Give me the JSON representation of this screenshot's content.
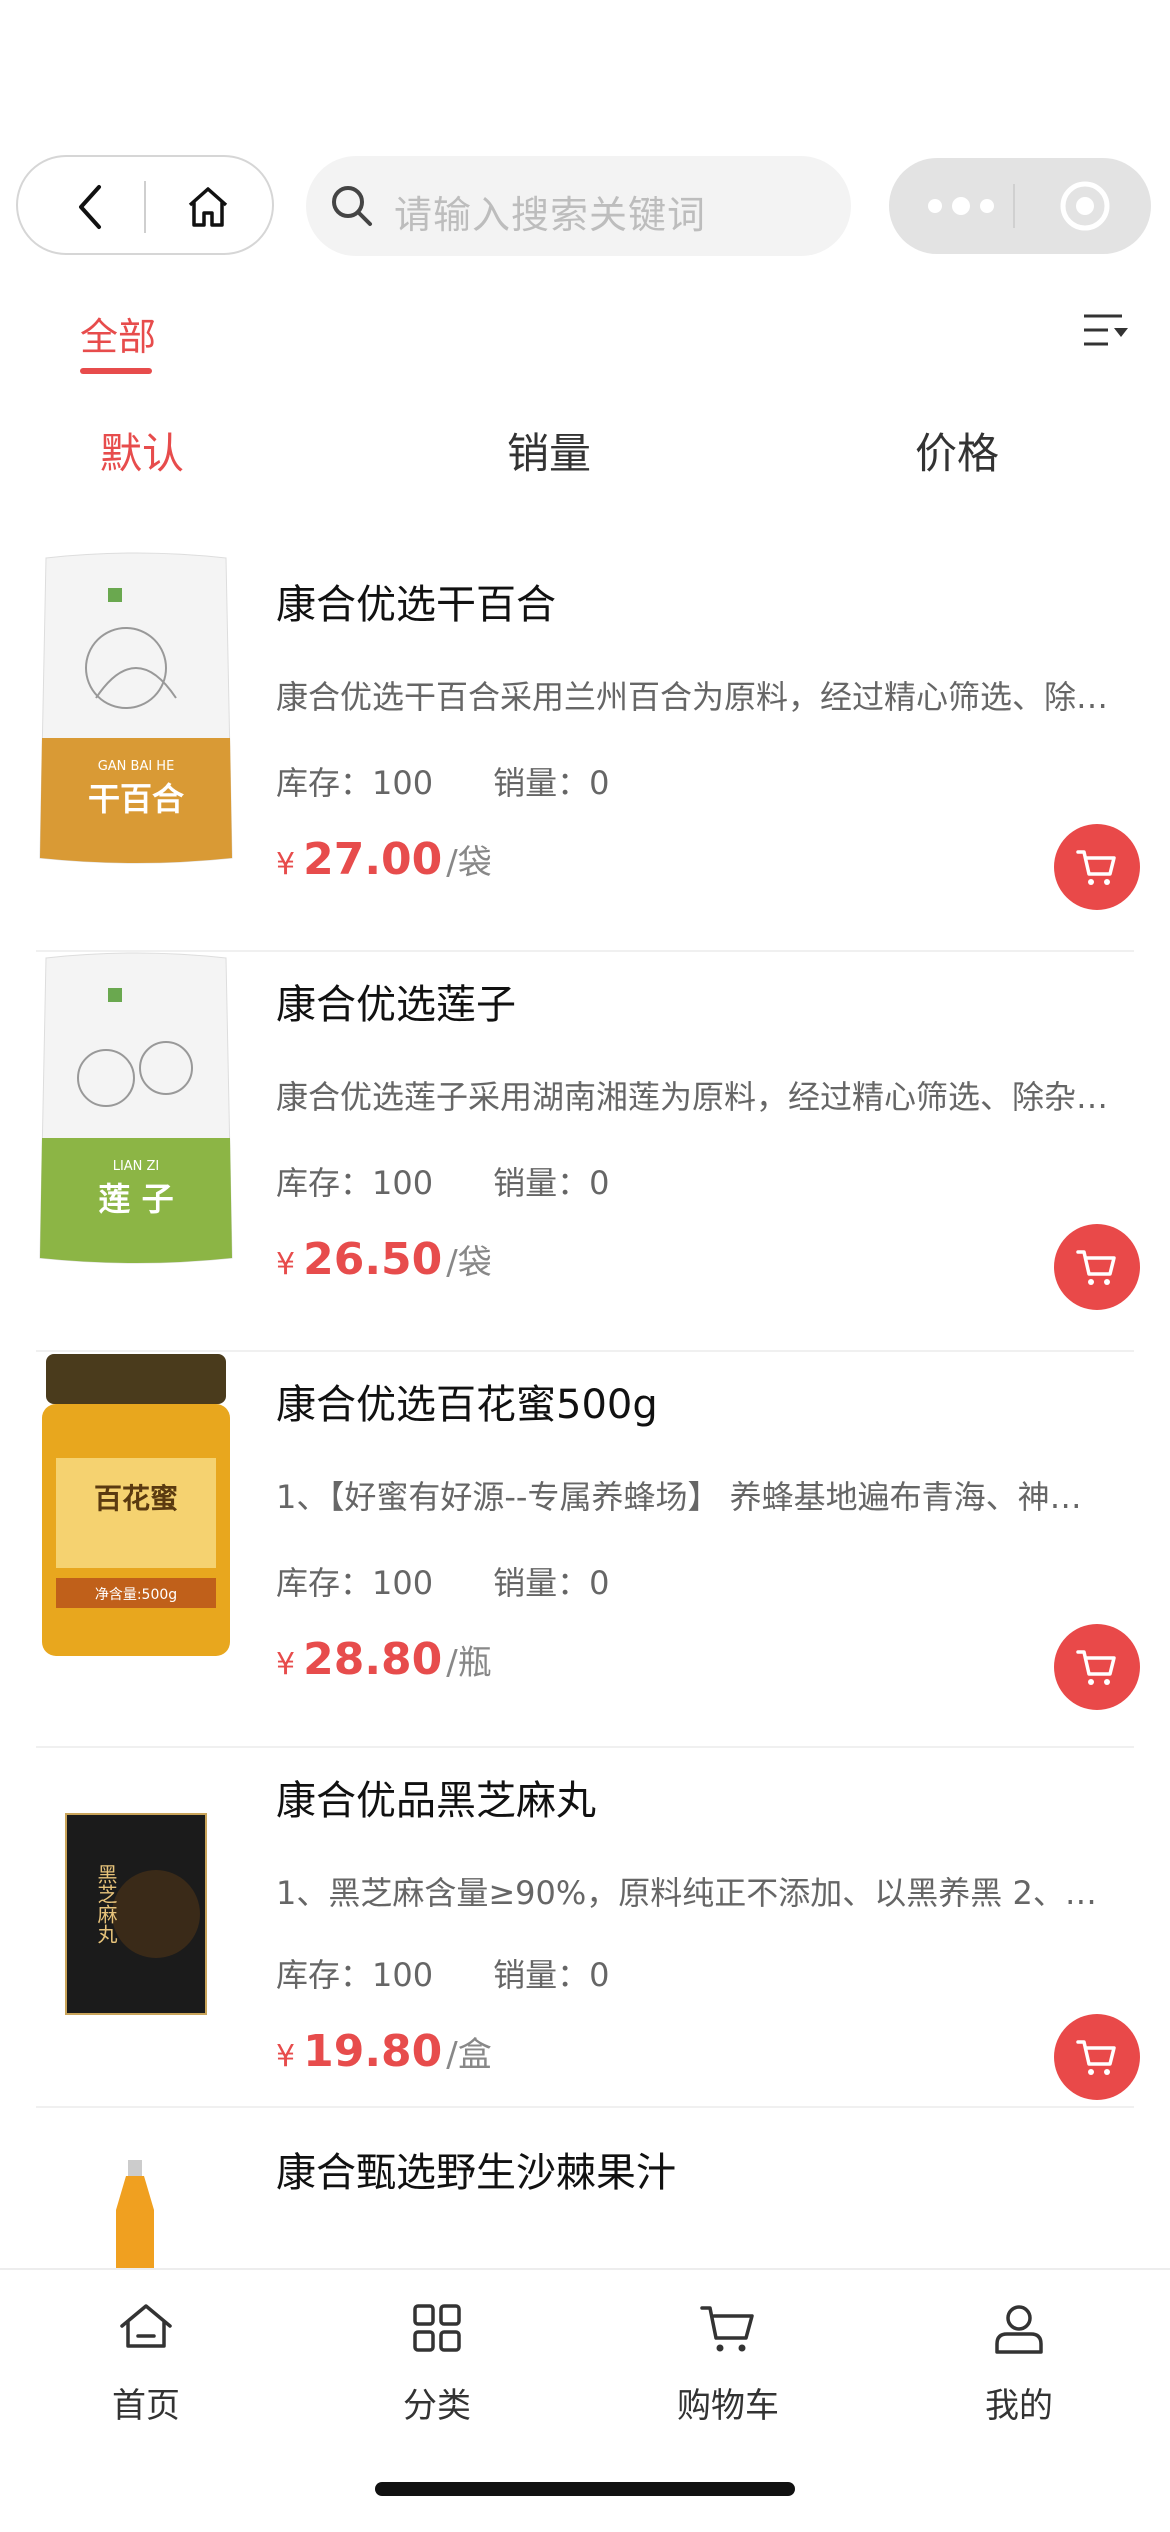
{
  "header": {
    "search_placeholder": "请输入搜索关键词"
  },
  "category_tabs": [
    {
      "label": "全部",
      "active": true
    }
  ],
  "sort": {
    "items": [
      "默认",
      "销量",
      "价格"
    ],
    "active": "默认"
  },
  "products": [
    {
      "name": "康合优选干百合",
      "desc": "康合优选干百合采用兰州百合为原料，经过精心筛选、除…",
      "stock_label": "库存：100",
      "sales_label": "销量：0",
      "currency": "¥",
      "price": "27.00",
      "unit": "/袋",
      "thumb_title": "干百合",
      "thumb_pinyin": "GAN BAI HE",
      "thumb_color": "#d99a35"
    },
    {
      "name": "康合优选莲子",
      "desc": "康合优选莲子采用湖南湘莲为原料，经过精心筛选、除杂…",
      "stock_label": "库存：100",
      "sales_label": "销量：0",
      "currency": "¥",
      "price": "26.50",
      "unit": "/袋",
      "thumb_title": "莲 子",
      "thumb_pinyin": "LIAN ZI",
      "thumb_color": "#8cb545"
    },
    {
      "name": "康合优选百花蜜500g",
      "desc": "1、【好蜜有好源--专属养蜂场】 养蜂基地遍布青海、神…",
      "stock_label": "库存：100",
      "sales_label": "销量：0",
      "currency": "¥",
      "price": "28.80",
      "unit": "/瓶",
      "thumb_title": "百花蜜",
      "thumb_sub": "净含量:500g",
      "thumb_color": "#e8a71e"
    },
    {
      "name": "康合优品黑芝麻丸",
      "desc": "1、黑芝麻含量≥90%，原料纯正不添加、以黑养黑 2、…",
      "stock_label": "库存：100",
      "sales_label": "销量：0",
      "currency": "¥",
      "price": "19.80",
      "unit": "/盒",
      "thumb_title": "黑芝麻丸",
      "thumb_color": "#1b1b1b"
    },
    {
      "name": "康合甄选野生沙棘果汁",
      "thumb_color": "#f0a020"
    }
  ],
  "tabbar": [
    {
      "label": "首页",
      "icon": "home-icon"
    },
    {
      "label": "分类",
      "icon": "category-grid-icon"
    },
    {
      "label": "购物车",
      "icon": "cart-icon"
    },
    {
      "label": "我的",
      "icon": "profile-icon"
    }
  ],
  "colors": {
    "accent": "#e74c4c",
    "cart_button": "#e94949"
  }
}
